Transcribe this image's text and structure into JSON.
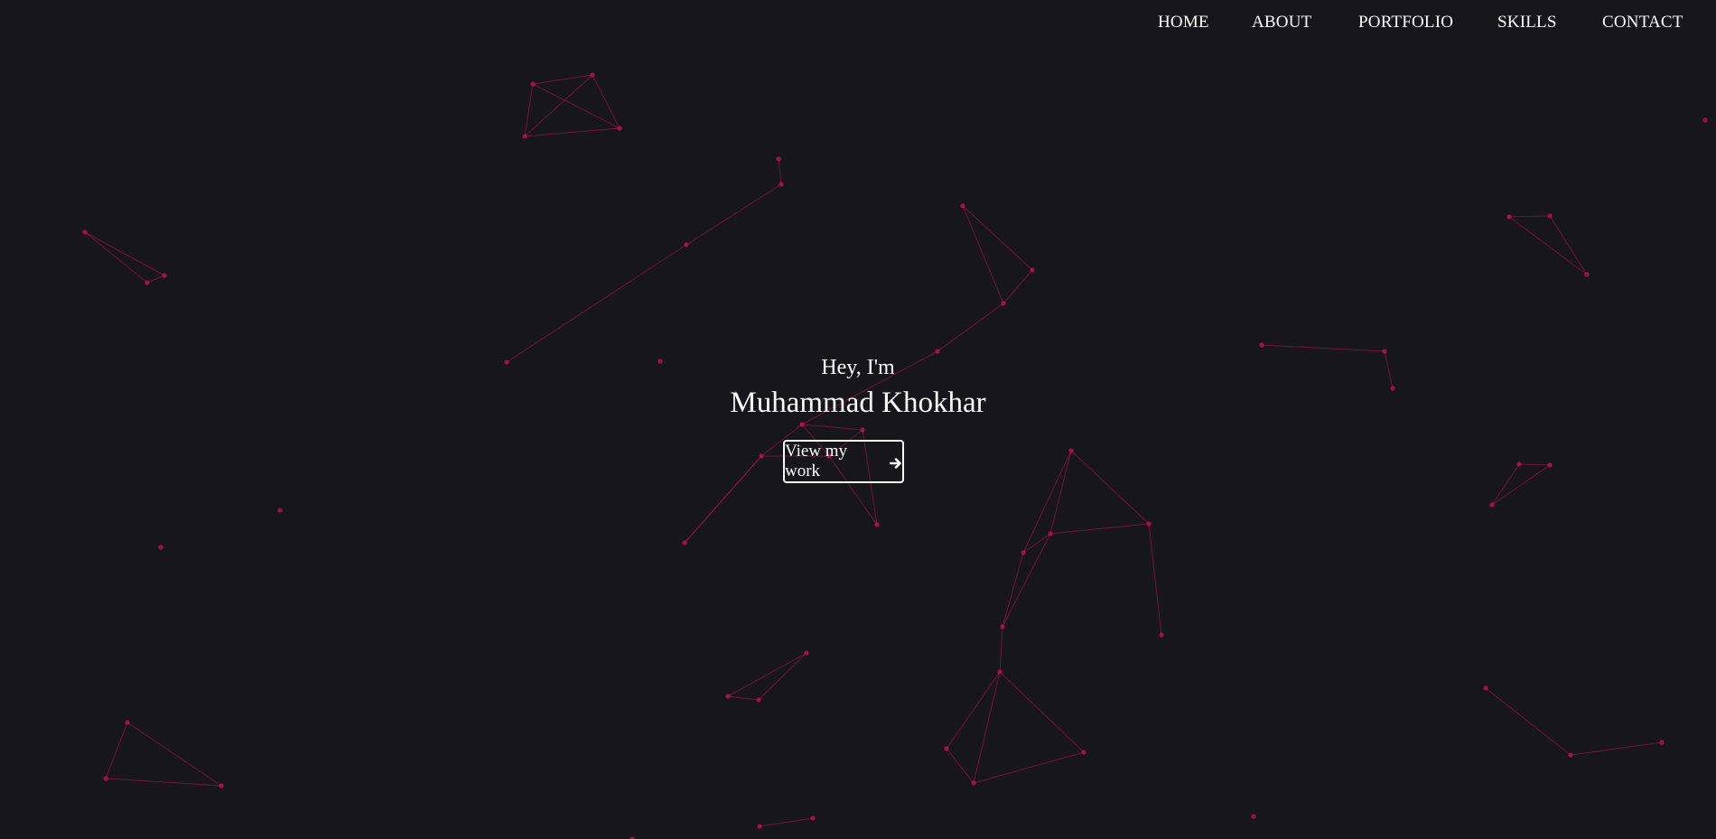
{
  "nav": {
    "items": [
      {
        "label": "HOME"
      },
      {
        "label": "ABOUT"
      },
      {
        "label": "PORTFOLIO"
      },
      {
        "label": "SKILLS"
      },
      {
        "label": "CONTACT"
      }
    ]
  },
  "hero": {
    "greeting": "Hey, I'm",
    "name": "Muhammad Khokhar",
    "cta_label": "View my work",
    "cta_icon": "arrow-right-icon"
  },
  "theme": {
    "background": "#17161c",
    "text": "#ffffff",
    "particle_color": "#c0134f"
  }
}
